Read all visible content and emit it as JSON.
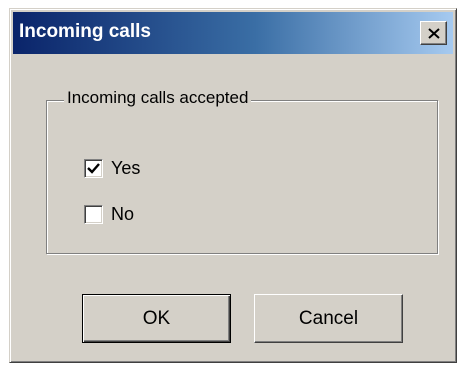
{
  "dialog": {
    "title": "Incoming calls",
    "close_icon": "close-icon",
    "group": {
      "label": "Incoming calls accepted",
      "options": [
        {
          "label": "Yes",
          "checked": true
        },
        {
          "label": "No",
          "checked": false
        }
      ]
    },
    "buttons": {
      "ok_label": "OK",
      "cancel_label": "Cancel"
    }
  },
  "colors": {
    "title_gradient_start": "#0a246a",
    "title_gradient_end": "#a6caf0",
    "face": "#d4d0c8"
  }
}
